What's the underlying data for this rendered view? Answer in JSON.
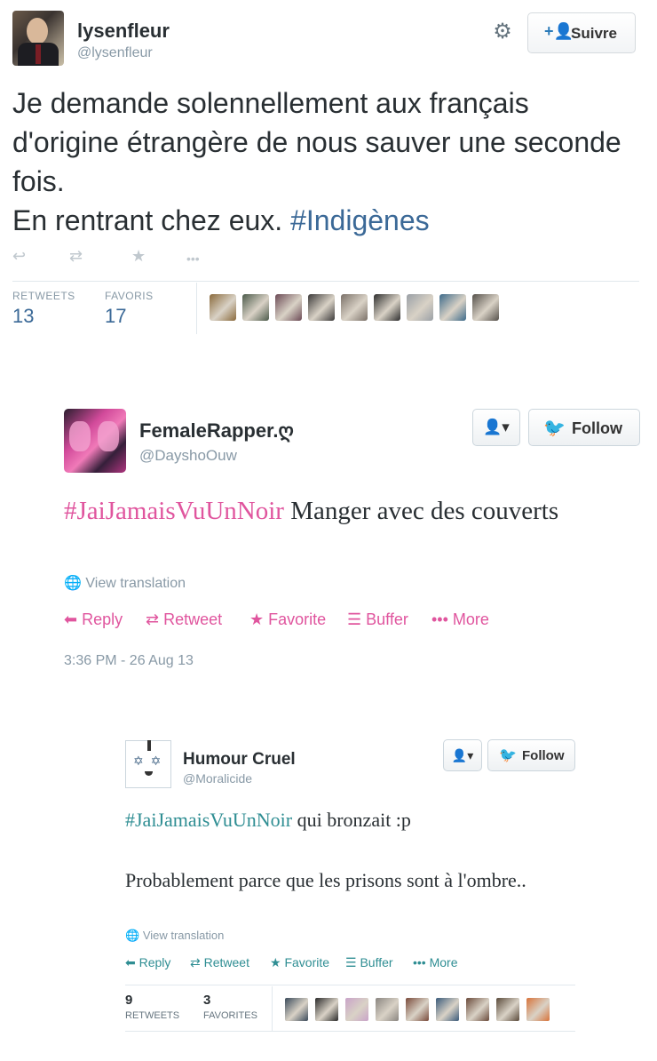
{
  "tweet1": {
    "display_name": "lysenfleur",
    "handle": "@lysenfleur",
    "follow_label": "Suivre",
    "text_part1": "Je demande solennellement aux français d'origine étrangère de nous sauver une seconde fois.",
    "text_part2": "En rentrant chez eux. ",
    "hashtag": "#Indigènes",
    "actions": {
      "reply_icon": "reply-icon",
      "retweet_icon": "retweet-icon",
      "favorite_icon": "star-icon",
      "more_icon": "more-icon",
      "more_glyph": "•••"
    },
    "retweets_label": "RETWEETS",
    "retweets_count": "13",
    "favorites_label": "FAVORIS",
    "favorites_count": "17",
    "favoriter_colors": [
      "#8a6a3c",
      "#4b5a4a",
      "#6b4a55",
      "#3c3a3a",
      "#7a7068",
      "#2e2e2e",
      "#9aa0a6",
      "#3d6a8a",
      "#55504a"
    ]
  },
  "tweet2": {
    "display_name": "FemaleRapper.ღ",
    "handle": "@DayshoOuw",
    "user_menu_glyph": "👤▾",
    "follow_label": "Follow",
    "hashtag": "#JaiJamaisVuUnNoir",
    "text_rest": " Manger avec des couverts",
    "view_translation": "View translation",
    "actions": {
      "reply": "Reply",
      "retweet": "Retweet",
      "favorite": "Favorite",
      "buffer": "Buffer",
      "more": "More"
    },
    "timestamp": "3:36 PM - 26 Aug 13",
    "accent_color": "#e0559e"
  },
  "tweet3": {
    "display_name": "Humour Cruel",
    "handle": "@Moralicide",
    "user_menu_glyph": "👤▾",
    "follow_label": "Follow",
    "hashtag": "#JaiJamaisVuUnNoir",
    "text_rest": " qui bronzait :p",
    "text_para2": "Probablement parce que les prisons sont à l'ombre..",
    "view_translation": "View translation",
    "actions": {
      "reply": "Reply",
      "retweet": "Retweet",
      "favorite": "Favorite",
      "buffer": "Buffer",
      "more": "More"
    },
    "retweets_count": "9",
    "retweets_label": "RETWEETS",
    "favorites_count": "3",
    "favorites_label": "FAVORITES",
    "favoriter_colors": [
      "#3a4a5a",
      "#2a2a2a",
      "#c9a3c8",
      "#8a8580",
      "#7a4a3a",
      "#3a5a7a",
      "#6a4a3a",
      "#5a4a3a",
      "#d8733a"
    ],
    "accent_color": "#2f8e93"
  }
}
